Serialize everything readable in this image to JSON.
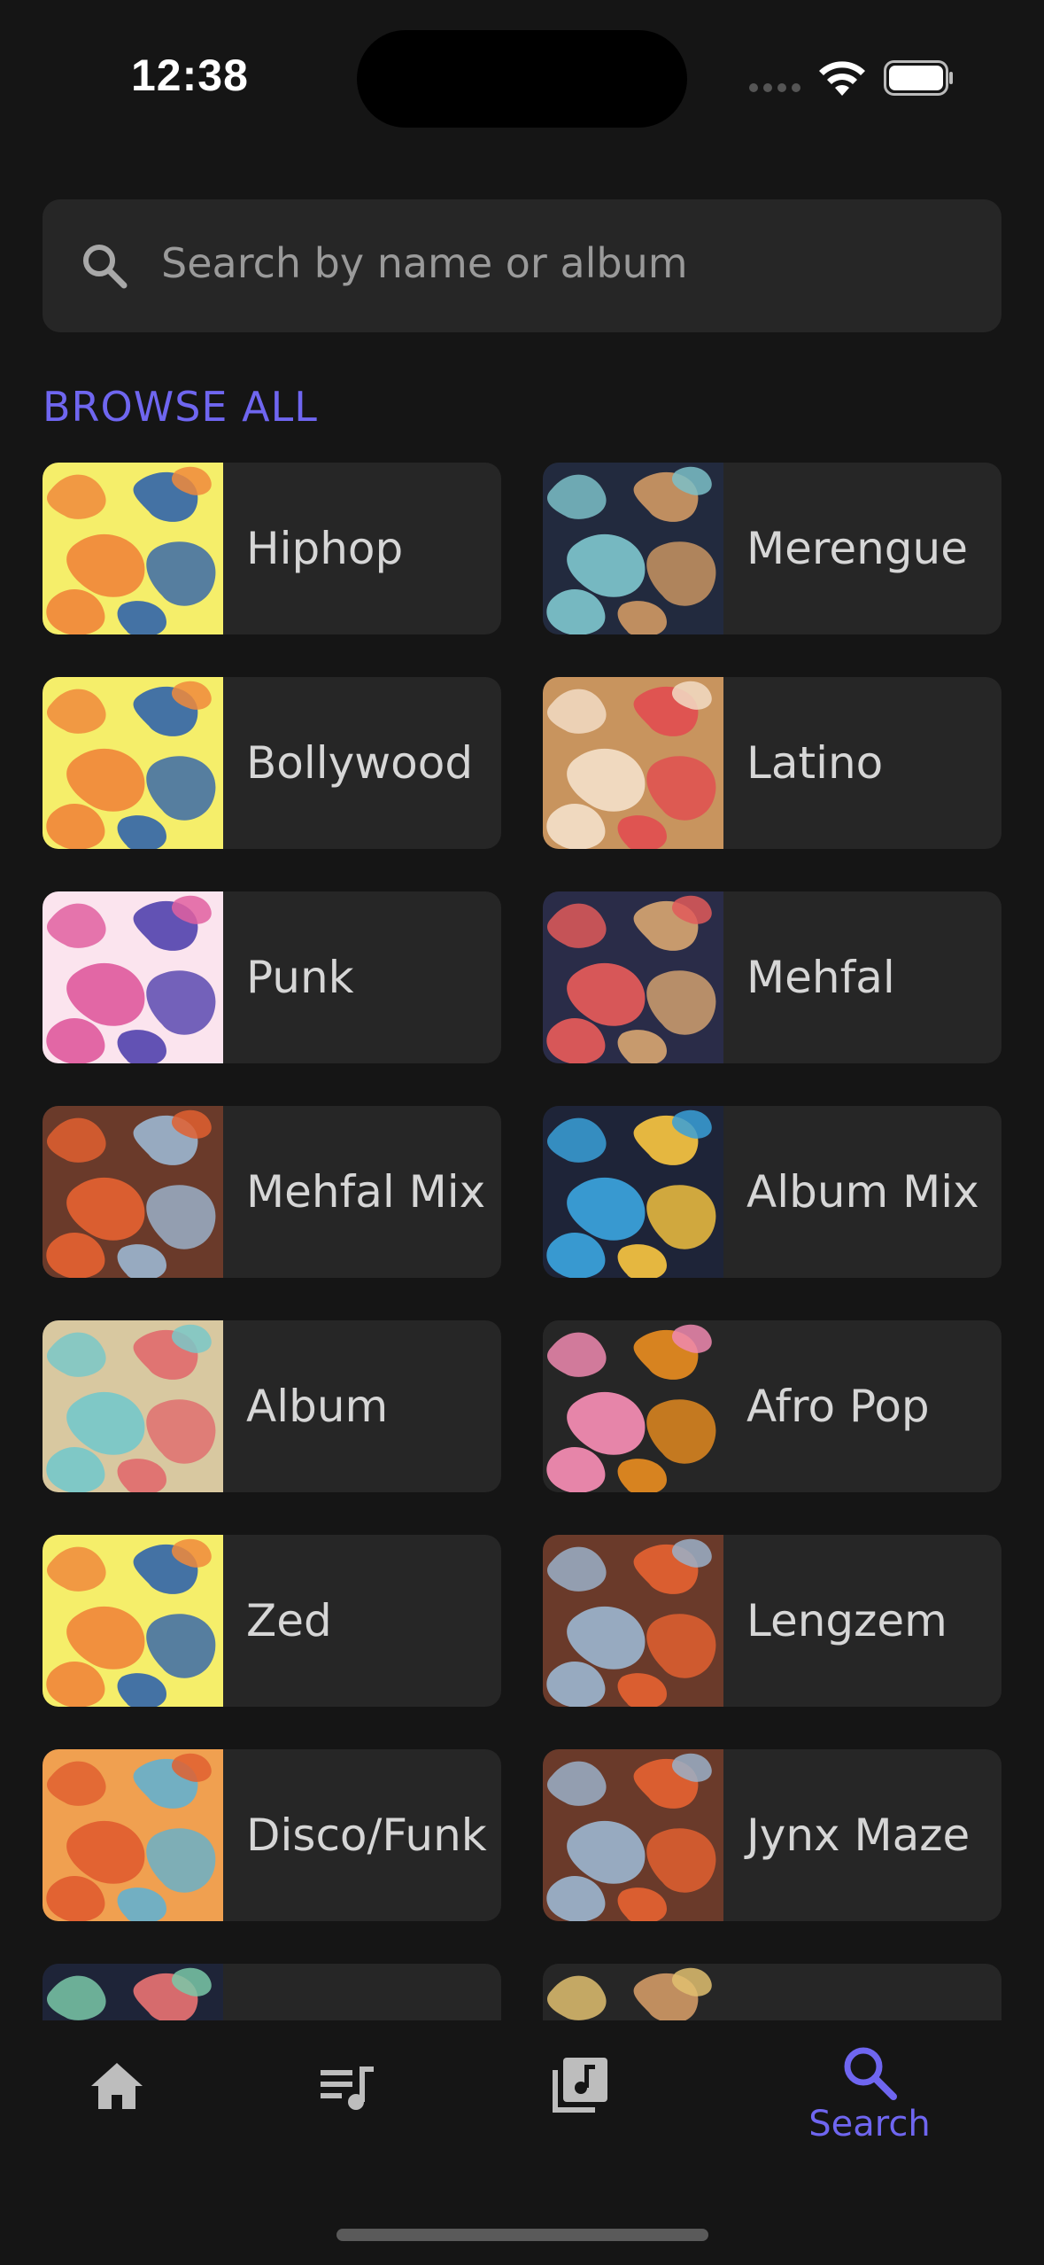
{
  "status_bar": {
    "time": "12:38"
  },
  "search": {
    "placeholder": "Search by name or album"
  },
  "browse": {
    "title": "BROWSE ALL",
    "genres": [
      {
        "label": "Hiphop",
        "colors": [
          "#f5ee6a",
          "#f08a3c",
          "#3a6aa8"
        ]
      },
      {
        "label": "Merengue",
        "colors": [
          "#222a3e",
          "#c89462",
          "#7bc0c8"
        ]
      },
      {
        "label": "Bollywood",
        "colors": [
          "#f5ee6a",
          "#f08a3c",
          "#3a6aa8"
        ]
      },
      {
        "label": "Latino",
        "colors": [
          "#c8945e",
          "#e05050",
          "#f2dcc4"
        ]
      },
      {
        "label": "Punk",
        "colors": [
          "#fbe4ee",
          "#e060a0",
          "#5a4ab0"
        ]
      },
      {
        "label": "Mehfal",
        "colors": [
          "#2a2c48",
          "#d0a070",
          "#e05a5a"
        ]
      },
      {
        "label": "Mehfal Mix",
        "colors": [
          "#6a3a2a",
          "#e06030",
          "#9ab0c8"
        ]
      },
      {
        "label": "Album Mix",
        "colors": [
          "#1e2438",
          "#f0c040",
          "#3aa0d8"
        ]
      },
      {
        "label": "Album",
        "colors": [
          "#d8c8a0",
          "#7ac8c8",
          "#e07070"
        ]
      },
      {
        "label": "Afro Pop",
        "colors": [
          "#262626",
          "#e08820",
          "#f08ab0"
        ]
      },
      {
        "label": "Zed",
        "colors": [
          "#f5ee6a",
          "#f08a3c",
          "#3a6aa8"
        ]
      },
      {
        "label": "Lengzem",
        "colors": [
          "#6a3a2a",
          "#e06030",
          "#9ab0c8"
        ]
      },
      {
        "label": "Disco/Funk",
        "colors": [
          "#f0a050",
          "#e06030",
          "#6ab0c8"
        ]
      },
      {
        "label": "Jynx Maze",
        "colors": [
          "#6a3a2a",
          "#e06030",
          "#9ab0c8"
        ]
      },
      {
        "label": "",
        "colors": [
          "#1e2438",
          "#7ac8a8",
          "#e07070"
        ]
      },
      {
        "label": "",
        "colors": [
          "#262626",
          "#c89462",
          "#e0c070"
        ]
      }
    ]
  },
  "tabbar": {
    "tabs": [
      {
        "icon": "home-icon"
      },
      {
        "icon": "queue-music-icon"
      },
      {
        "icon": "library-music-icon"
      },
      {
        "icon": "search-icon",
        "label": "Search",
        "active": true
      }
    ],
    "active_color": "#6f66f0",
    "inactive_color": "#bdbdbd"
  }
}
